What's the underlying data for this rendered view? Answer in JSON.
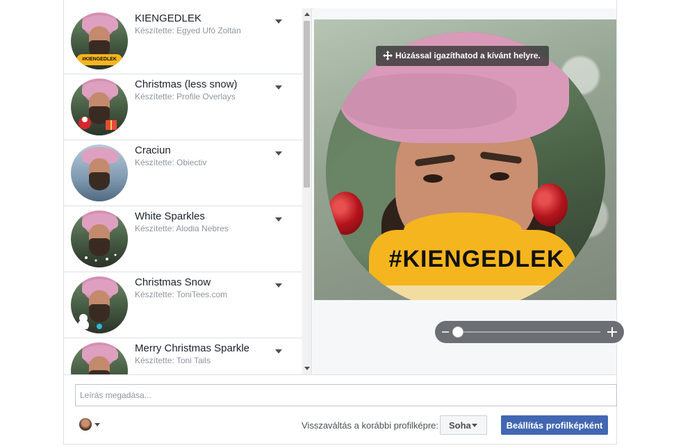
{
  "frames": [
    {
      "title": "KIENGEDLEK",
      "author": "Készítette: Egyed Ufó Zoltán",
      "badge": "#KIENGEDLEK"
    },
    {
      "title": "Christmas (less snow)",
      "author": "Készítette: Profile Overlays",
      "badge": ""
    },
    {
      "title": "Craciun",
      "author": "Készítette: Obiectiv",
      "badge": ""
    },
    {
      "title": "White Sparkles",
      "author": "Készítette: Alodia Nebres",
      "badge": ""
    },
    {
      "title": "Christmas Snow",
      "author": "Készítette: ToniTees.com",
      "badge": ""
    },
    {
      "title": "Merry Christmas Sparkle",
      "author": "Készítette: Toni Tails",
      "badge": ""
    }
  ],
  "preview": {
    "drag_tip": "Húzással igazíthatod a kívánt helyre.",
    "overlay_text": "#KIENGEDLEK",
    "zoom_level": 0.0
  },
  "description": {
    "placeholder": "Leírás megadása..."
  },
  "footer": {
    "revert_label": "Visszaváltás a korábbi profilképre:",
    "revert_value": "Soha",
    "set_button": "Beállítás profilképként"
  },
  "colors": {
    "primary_button": "#4267b2",
    "overlay_yellow": "#f5b51e",
    "border": "#dddfe2"
  }
}
